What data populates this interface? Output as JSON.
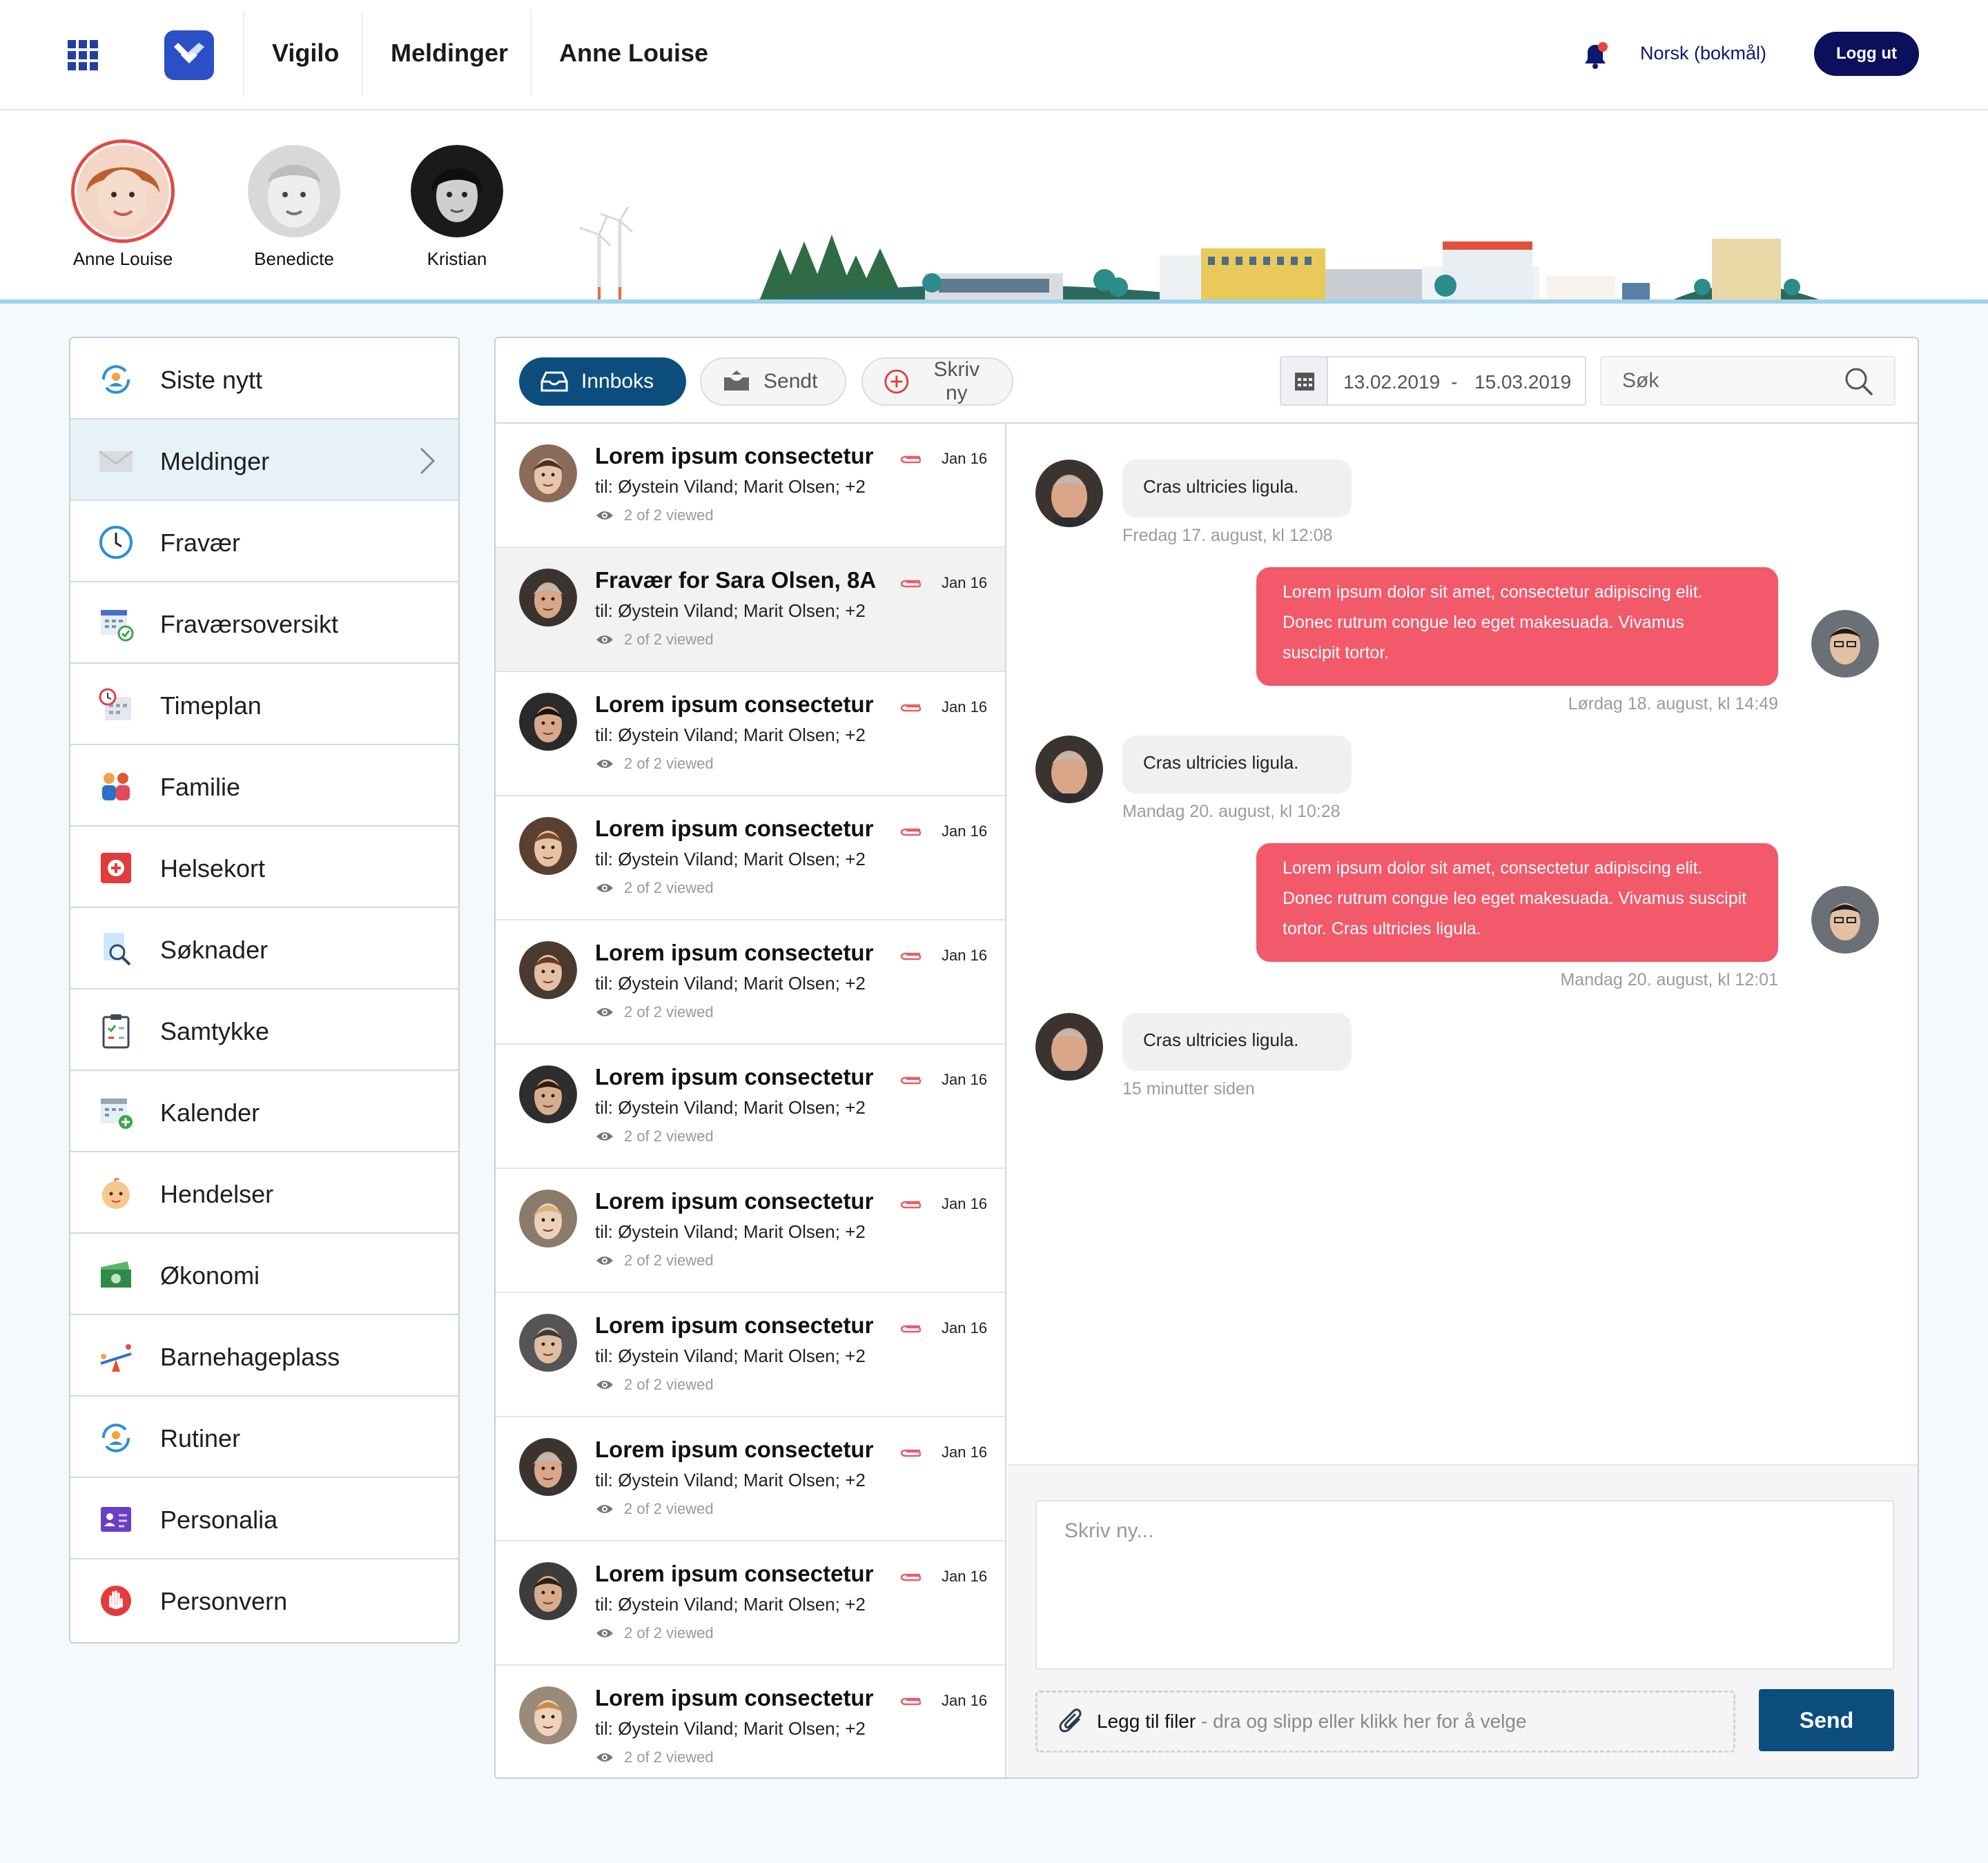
{
  "topbar": {
    "nav": [
      "Vigilo",
      "Meldinger",
      "Anne Louise"
    ],
    "language": "Norsk (bokmål)",
    "logout_label": "Logg ut",
    "brand_color": "#2b4fc7"
  },
  "children": [
    {
      "name": "Anne Louise",
      "selected": true
    },
    {
      "name": "Benedicte",
      "selected": false
    },
    {
      "name": "Kristian",
      "selected": false
    }
  ],
  "sidebar": {
    "items": [
      {
        "label": "Siste nytt",
        "icon": "refresh-person-icon"
      },
      {
        "label": "Meldinger",
        "icon": "envelope-icon",
        "active": true
      },
      {
        "label": "Fravær",
        "icon": "clock-icon"
      },
      {
        "label": "Fraværsoversikt",
        "icon": "calendar-check-icon"
      },
      {
        "label": "Timeplan",
        "icon": "timetable-icon"
      },
      {
        "label": "Familie",
        "icon": "family-icon"
      },
      {
        "label": "Helsekort",
        "icon": "health-card-icon"
      },
      {
        "label": "Søknader",
        "icon": "search-document-icon"
      },
      {
        "label": "Samtykke",
        "icon": "clipboard-icon"
      },
      {
        "label": "Kalender",
        "icon": "calendar-plus-icon"
      },
      {
        "label": "Hendelser",
        "icon": "baby-face-icon"
      },
      {
        "label": "Økonomi",
        "icon": "money-icon"
      },
      {
        "label": "Barnehageplass",
        "icon": "seesaw-icon"
      },
      {
        "label": "Rutiner",
        "icon": "refresh-person-icon"
      },
      {
        "label": "Personalia",
        "icon": "id-card-icon"
      },
      {
        "label": "Personvern",
        "icon": "stop-hand-icon"
      }
    ]
  },
  "toolbar": {
    "inbox": "Innboks",
    "sent": "Sendt",
    "compose": "Skriv ny",
    "date_from": "13.02.2019",
    "date_sep": "-",
    "date_to": "15.03.2019",
    "search_placeholder": "Søk"
  },
  "messages": [
    {
      "title": "Lorem ipsum consectetur",
      "to": "til: Øystein Viland; Marit Olsen; +2",
      "viewed": "2 of 2 viewed",
      "date": "Jan 16",
      "selected": false
    },
    {
      "title": "Fravær for Sara Olsen, 8A",
      "to": "til: Øystein Viland; Marit Olsen; +2",
      "viewed": "2 of 2 viewed",
      "date": "Jan 16",
      "selected": true
    },
    {
      "title": "Lorem ipsum consectetur",
      "to": "til: Øystein Viland; Marit Olsen; +2",
      "viewed": "2 of 2 viewed",
      "date": "Jan 16",
      "selected": false
    },
    {
      "title": "Lorem ipsum consectetur",
      "to": "til: Øystein Viland; Marit Olsen; +2",
      "viewed": "2 of 2 viewed",
      "date": "Jan 16",
      "selected": false
    },
    {
      "title": "Lorem ipsum consectetur",
      "to": "til: Øystein Viland; Marit Olsen; +2",
      "viewed": "2 of 2 viewed",
      "date": "Jan 16",
      "selected": false
    },
    {
      "title": "Lorem ipsum consectetur",
      "to": "til: Øystein Viland; Marit Olsen; +2",
      "viewed": "2 of 2 viewed",
      "date": "Jan 16",
      "selected": false
    },
    {
      "title": "Lorem ipsum consectetur",
      "to": "til: Øystein Viland; Marit Olsen; +2",
      "viewed": "2 of 2 viewed",
      "date": "Jan 16",
      "selected": false
    },
    {
      "title": "Lorem ipsum consectetur",
      "to": "til: Øystein Viland; Marit Olsen; +2",
      "viewed": "2 of 2 viewed",
      "date": "Jan 16",
      "selected": false
    },
    {
      "title": "Lorem ipsum consectetur",
      "to": "til: Øystein Viland; Marit Olsen; +2",
      "viewed": "2 of 2 viewed",
      "date": "Jan 16",
      "selected": false
    },
    {
      "title": "Lorem ipsum consectetur",
      "to": "til: Øystein Viland; Marit Olsen; +2",
      "viewed": "2 of 2 viewed",
      "date": "Jan 16",
      "selected": false
    },
    {
      "title": "Lorem ipsum consectetur",
      "to": "til: Øystein Viland; Marit Olsen; +2",
      "viewed": "2 of 2 viewed",
      "date": "Jan 16",
      "selected": false
    }
  ],
  "chat": {
    "accent": "#f2596a",
    "messages": [
      {
        "dir": "in",
        "lines": [
          "Cras ultricies ligula."
        ],
        "time": "Fredag 17. august,  kl 12:08"
      },
      {
        "dir": "out",
        "lines": [
          "Lorem ipsum dolor sit amet, consectetur adipiscing  elit.",
          "Donec rutrum congue leo eget makesuada.  Vivamus",
          "suscipit tortor."
        ],
        "time": "Lørdag 18. august,  kl 14:49"
      },
      {
        "dir": "in",
        "lines": [
          "Cras ultricies ligula."
        ],
        "time": "Mandag 20. august,  kl 10:28"
      },
      {
        "dir": "out",
        "lines": [
          "Lorem ipsum dolor sit amet, consectetur adipiscing  elit.",
          "Donec rutrum congue leo eget makesuada.  Vivamus suscipit",
          "tortor. Cras ultricies ligula."
        ],
        "time": "Mandag 20. august,  kl 12:01"
      },
      {
        "dir": "in",
        "lines": [
          "Cras ultricies ligula."
        ],
        "time": "15 minutter siden"
      }
    ]
  },
  "composer": {
    "placeholder": "Skriv ny...",
    "attach_strong": "Legg til filer",
    "attach_rest": " - dra og slipp eller klikk her for å velge",
    "send_label": "Send"
  }
}
